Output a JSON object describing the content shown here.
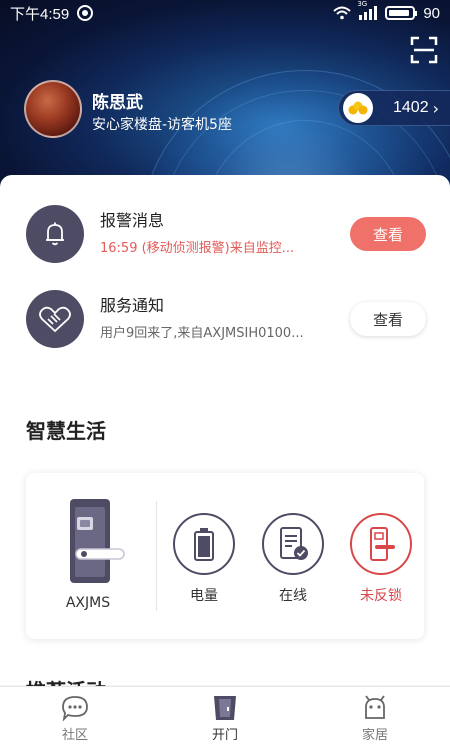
{
  "status_bar": {
    "time": "下午4:59",
    "battery": "90",
    "network": "3G",
    "battery_level": 0.9
  },
  "header": {
    "user_name": "陈思武",
    "user_location": "安心家楼盘-访客机5座",
    "points": "1402",
    "points_arrow": "›"
  },
  "messages": [
    {
      "title": "报警消息",
      "desc": "16:59 (移动侦测报警)来自监控...",
      "button": "查看",
      "desc_color": "#e25b57",
      "icon": "bell-icon"
    },
    {
      "title": "服务通知",
      "desc": "用户9回来了,来自AXJMSIH0100...",
      "button": "查看",
      "desc_color": "#666666",
      "icon": "handshake-icon"
    }
  ],
  "smart_life": {
    "title": "智慧生活",
    "device_name": "AXJMS",
    "stats": [
      {
        "label": "电量",
        "icon": "battery-icon"
      },
      {
        "label": "在线",
        "icon": "device-online-icon"
      },
      {
        "label": "未反锁",
        "icon": "door-lock-icon",
        "color": "#d9474a"
      }
    ]
  },
  "next_section": {
    "title": "推荐活动"
  },
  "tabs": [
    {
      "label": "社区",
      "icon": "chat-bubble-icon"
    },
    {
      "label": "开门",
      "icon": "door-icon",
      "active": true
    },
    {
      "label": "家居",
      "icon": "android-icon"
    }
  ],
  "colors": {
    "accent": "#f0706a",
    "icon_dark": "#4e4c64",
    "alert": "#d9474a"
  }
}
